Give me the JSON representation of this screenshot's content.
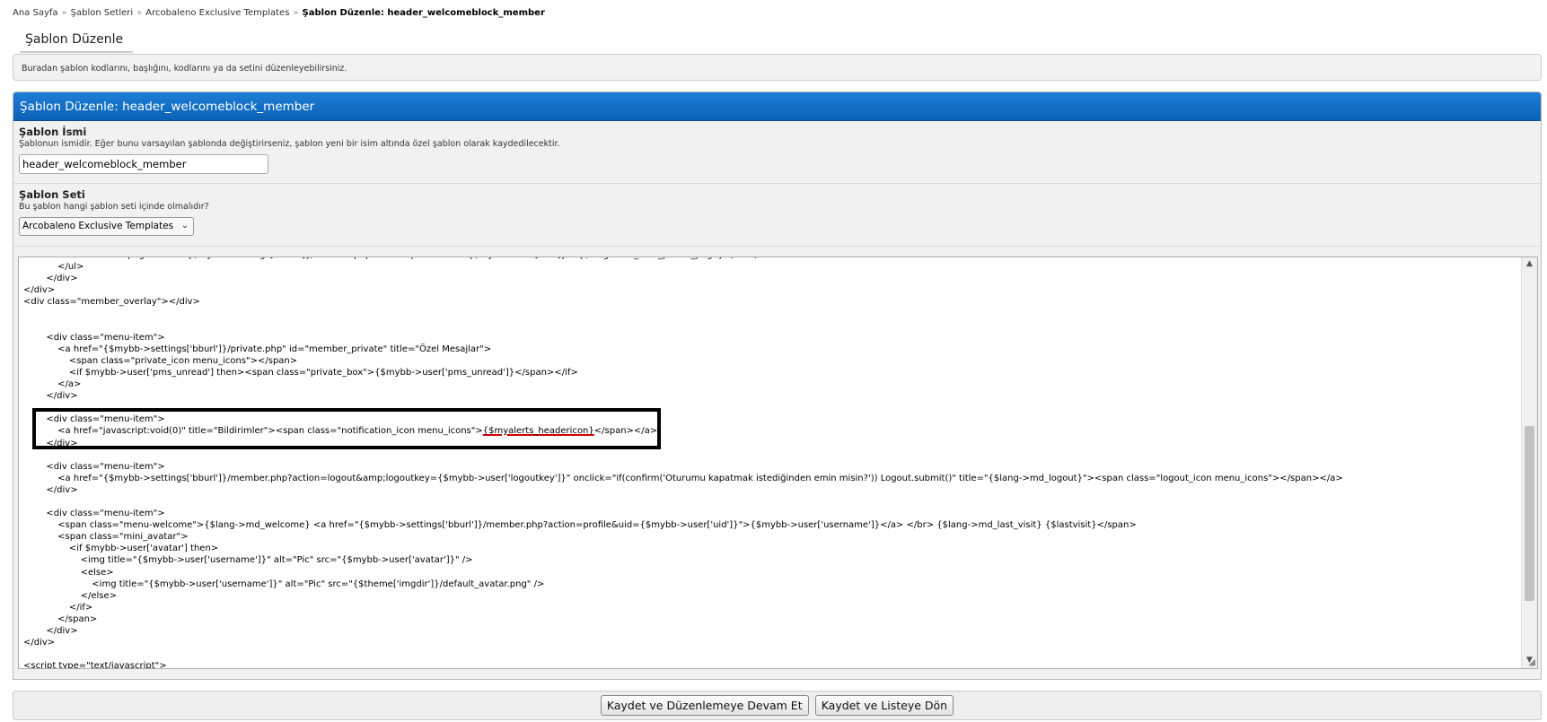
{
  "breadcrumb": {
    "items": [
      "Ana Sayfa",
      "Şablon Setleri",
      "Arcobaleno Exclusive Templates"
    ],
    "current": "Şablon Düzenle: header_welcomeblock_member"
  },
  "page_tab": "Şablon Düzenle",
  "description": "Buradan şablon kodlarını, başlığını, kodlarını ya da setini düzenleyebilirsiniz.",
  "form": {
    "header": "Şablon Düzenle: header_welcomeblock_member",
    "template_name": {
      "label": "Şablon İsmi",
      "help": "Şablonun ismidir. Eğer bunu varsayılan şablonda değiştirirseniz, şablon yeni bir isim altında özel şablon olarak kaydedilecektir.",
      "value": "header_welcomeblock_member"
    },
    "template_set": {
      "label": "Şablon Seti",
      "help": "Bu şablon hangi şablon seti içinde olmalıdır?",
      "selected": "Arcobaleno Exclusive Templates"
    }
  },
  "editor": {
    "lines": [
      "                <a class=\"mpage\" href=\"{$mybb->settings['bburl']}/member.php?action=profile&uid={$mybb->user['uid']}\">{$lang->md_user_profile_page}</a></li>",
      "            </ul>",
      "        </div>",
      "</div>",
      "<div class=\"member_overlay\"></div>",
      "",
      "",
      "        <div class=\"menu-item\">",
      "            <a href=\"{$mybb->settings['bburl']}/private.php\" id=\"member_private\" title=\"Özel Mesajlar\">",
      "                <span class=\"private_icon menu_icons\"></span>",
      "                <if $mybb->user['pms_unread'] then><span class=\"private_box\">{$mybb->user['pms_unread']}</span></if>",
      "            </a>",
      "        </div>",
      "",
      "        <div class=\"menu-item\">",
      "            <a href=\"javascript:void(0)\" title=\"Bildirimler\"><span class=\"notification_icon menu_icons\">",
      "        </div>",
      "",
      "        <div class=\"menu-item\">",
      "            <a href=\"{$mybb->settings['bburl']}/member.php?action=logout&amp;logoutkey={$mybb->user['logoutkey']}\" onclick=\"if(confirm('Oturumu kapatmak istediğinden emin misin?')) Logout.submit()\" title=\"{$lang->md_logout}\"><span class=\"logout_icon menu_icons\"></span></a>",
      "        </div>",
      "",
      "        <div class=\"menu-item\">",
      "            <span class=\"menu-welcome\">{$lang->md_welcome} <a href=\"{$mybb->settings['bburl']}/member.php?action=profile&uid={$mybb->user['uid']}\">{$mybb->user['username']}</a> </br> {$lang->md_last_visit} {$lastvisit}</span>",
      "            <span class=\"mini_avatar\">",
      "                <if $mybb->user['avatar'] then>",
      "                    <img title=\"{$mybb->user['username']}\" alt=\"Pic\" src=\"{$mybb->user['avatar']}\" />",
      "                    <else>",
      "                        <img title=\"{$mybb->user['username']}\" alt=\"Pic\" src=\"{$theme['imgdir']}/default_avatar.png\" />",
      "                    </else>",
      "                </if>",
      "            </span>",
      "        </div>",
      "</div>",
      "",
      "<script type=\"text/javascript\">"
    ],
    "highlight_token": "{$myalerts_headericon}",
    "highlight_tail": "</span></a>"
  },
  "buttons": {
    "save_continue": "Kaydet ve Düzenlemeye Devam Et",
    "save_list": "Kaydet ve Listeye Dön"
  }
}
